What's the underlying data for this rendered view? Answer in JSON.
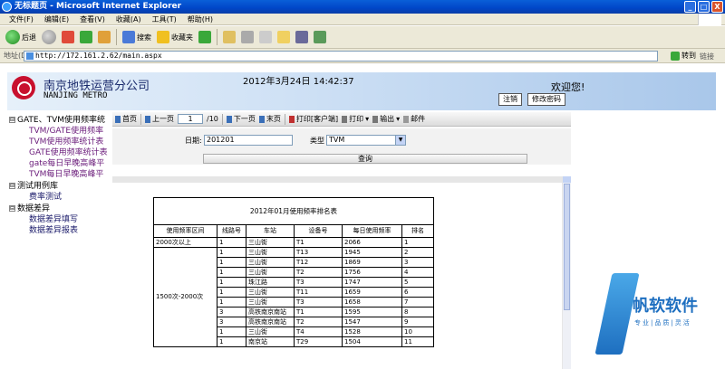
{
  "window": {
    "title": "无标题页 - Microsoft Internet Explorer",
    "buttons": [
      "_",
      "□",
      "X"
    ]
  },
  "menu": [
    "文件(F)",
    "编辑(E)",
    "查看(V)",
    "收藏(A)",
    "工具(T)",
    "帮助(H)"
  ],
  "toolbar": {
    "back": "后退",
    "search": "搜索",
    "favorites": "收藏夹"
  },
  "address": {
    "label": "地址(D)",
    "url": "http://172.161.2.62/main.aspx",
    "go": "转到",
    "links": "链接"
  },
  "header": {
    "company": "南京地铁运营分公司",
    "company_en": "NANJING METRO",
    "datetime": "2012年3月24日  14:42:37",
    "welcome": "欢迎您!",
    "logout": "注销",
    "change_password": "修改密码"
  },
  "sidebar": {
    "items": [
      {
        "label": "GATE、TVM使用频率统",
        "level": 0,
        "expander": "⊟"
      },
      {
        "label": "TVM/GATE使用频率",
        "level": 1
      },
      {
        "label": "TVM使用频率统计表",
        "level": 1
      },
      {
        "label": "GATE使用频率统计表",
        "level": 1
      },
      {
        "label": "gate每日早晚高峰平",
        "level": 1
      },
      {
        "label": "TVM每日早晚高峰平",
        "level": 1
      },
      {
        "label": "测试用例库",
        "level": 0,
        "expander": "⊟"
      },
      {
        "label": "费率测试",
        "level": 2
      },
      {
        "label": "数据差异",
        "level": 0,
        "expander": "⊟"
      },
      {
        "label": "数据差异填写",
        "level": 2
      },
      {
        "label": "数据差异报表",
        "level": 2
      }
    ]
  },
  "report_toolbar": {
    "first": "首页",
    "prev": "上一页",
    "page": "1",
    "total": "/10",
    "next": "下一页",
    "last": "末页",
    "print_client": "打印[客户端]",
    "print": "打印",
    "export": "输出",
    "mail": "邮件"
  },
  "filter": {
    "date_label": "日期:",
    "date_value": "201201",
    "type_label": "类型",
    "type_value": "TVM",
    "query": "查询"
  },
  "report": {
    "title": "2012年01月使用频率排名表",
    "headers": [
      "使用频率区间",
      "线路号",
      "车站",
      "设备号",
      "每日使用频率",
      "排名"
    ],
    "group1": "2000次以上",
    "group2": "1500次-2000次",
    "rows": [
      {
        "line": "1",
        "station": "三山街",
        "device": "T1",
        "freq": "2066",
        "rank": "1"
      },
      {
        "line": "1",
        "station": "三山街",
        "device": "T13",
        "freq": "1945",
        "rank": "2"
      },
      {
        "line": "1",
        "station": "三山街",
        "device": "T12",
        "freq": "1869",
        "rank": "3"
      },
      {
        "line": "1",
        "station": "三山街",
        "device": "T2",
        "freq": "1756",
        "rank": "4"
      },
      {
        "line": "1",
        "station": "珠江路",
        "device": "T3",
        "freq": "1747",
        "rank": "5"
      },
      {
        "line": "1",
        "station": "三山街",
        "device": "T11",
        "freq": "1659",
        "rank": "6"
      },
      {
        "line": "1",
        "station": "三山街",
        "device": "T3",
        "freq": "1658",
        "rank": "7"
      },
      {
        "line": "3",
        "station": "高铁南京南站",
        "device": "T1",
        "freq": "1595",
        "rank": "8"
      },
      {
        "line": "3",
        "station": "高铁南京南站",
        "device": "T2",
        "freq": "1547",
        "rank": "9"
      },
      {
        "line": "1",
        "station": "三山街",
        "device": "T4",
        "freq": "1528",
        "rank": "10"
      },
      {
        "line": "1",
        "station": "南京站",
        "device": "T29",
        "freq": "1504",
        "rank": "11"
      }
    ]
  },
  "watermark": {
    "brand": "帆软软件",
    "sub": "专业|品质|灵活"
  },
  "colors": {
    "title_bar": "#0046c8",
    "header_gradient_end": "#a9c7ea",
    "logo": "#c8102e",
    "sidebar_link": "#6a1b7a"
  }
}
